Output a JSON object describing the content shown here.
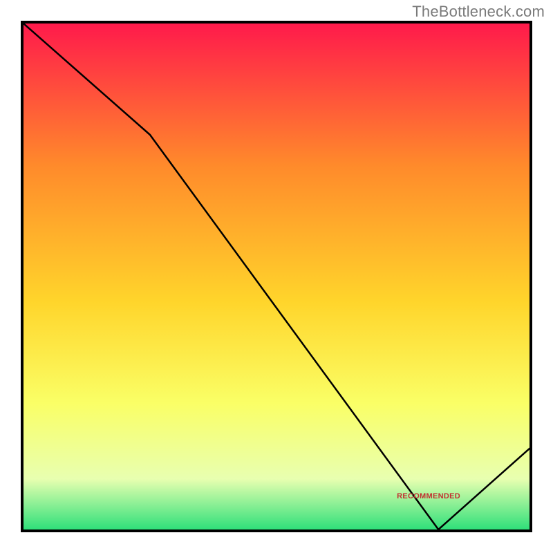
{
  "watermark": "TheBottleneck.com",
  "bottom_label": "RECOMMENDED",
  "colors": {
    "border": "#000000",
    "line": "#000000",
    "grad_top": "#ff1a4b",
    "grad_mid_upper": "#ff8a2b",
    "grad_mid": "#ffd52b",
    "grad_mid_lower": "#faff66",
    "grad_low": "#e8ffb0",
    "grad_bottom": "#2fe07a"
  },
  "chart_data": {
    "type": "line",
    "title": "",
    "xlabel": "",
    "ylabel": "",
    "xlim": [
      0,
      100
    ],
    "ylim": [
      0,
      100
    ],
    "x": [
      0,
      25,
      82,
      100
    ],
    "y": [
      100,
      78,
      0,
      16
    ],
    "notes": "Vertical gradient background from red (top) through orange/yellow to green (bottom). Black polyline descends from top-left, with a slope change near x≈25, reaches the x-axis near x≈82, then rises to about y≈16 at x=100."
  }
}
